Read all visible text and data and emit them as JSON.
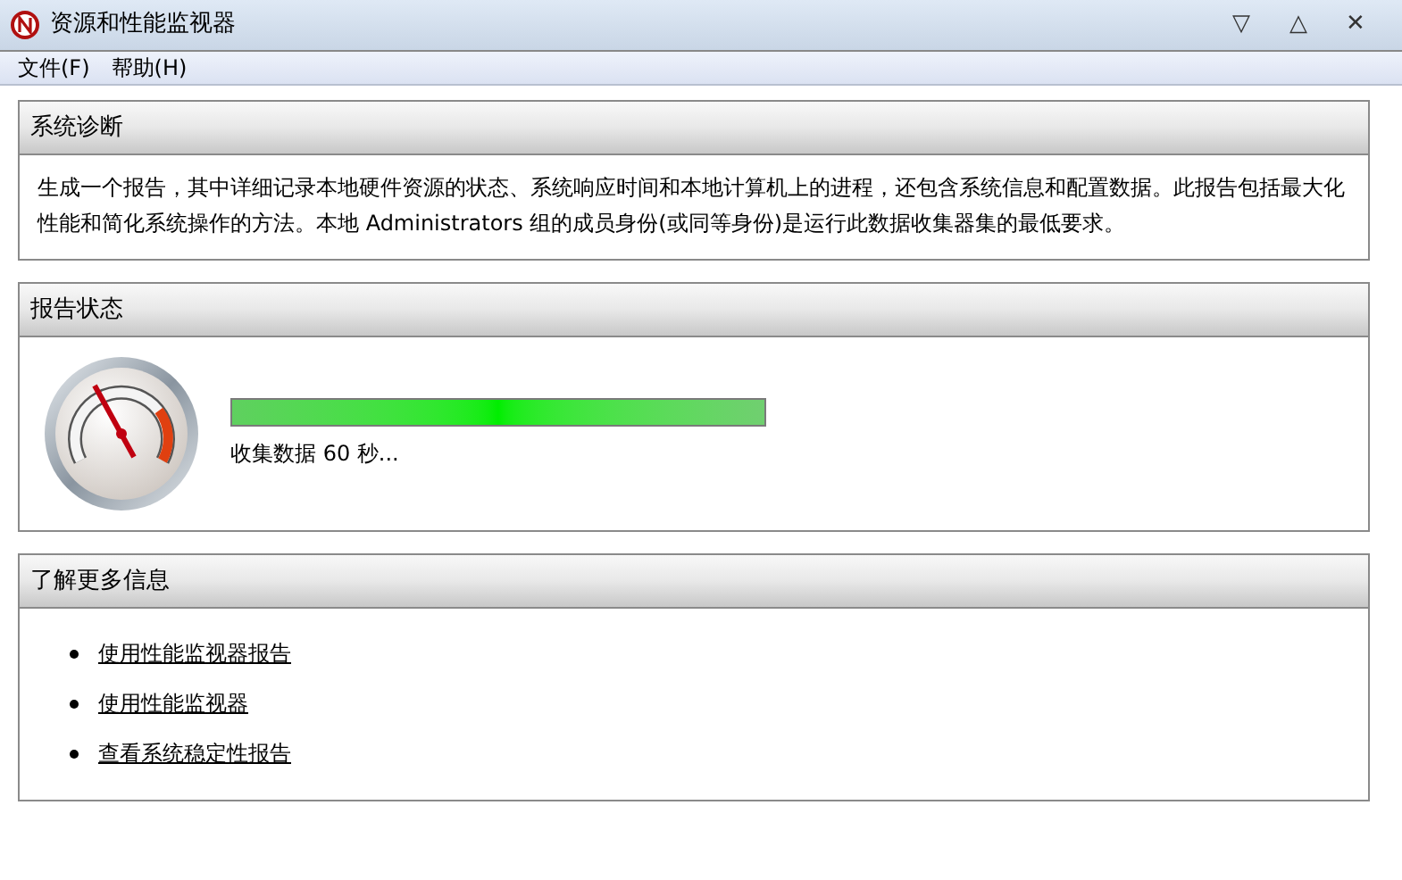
{
  "window": {
    "title": "资源和性能监视器",
    "controls": [
      "▽",
      "△",
      "✕"
    ]
  },
  "menu": [
    {
      "label": "文件(F)"
    },
    {
      "label": "帮助(H)"
    }
  ],
  "sections": [
    {
      "kind": "text",
      "title": "系统诊断",
      "text": "生成一个报告，其中详细记录本地硬件资源的状态、系统响应时间和本地计算机上的进程，还包含系统信息和配置数据。此报告包括最大化性能和简化系统操作的方法。本地 Administrators 组的成员身份(或同等身份)是运行此数据收集器集的最低要求。"
    },
    {
      "kind": "status",
      "title": "报告状态",
      "progress": {
        "level": 1.0,
        "caption": "收集数据 60 秒..."
      }
    },
    {
      "kind": "links",
      "title": "了解更多信息",
      "links": [
        "使用性能监视器报告",
        "使用性能监视器",
        "查看系统稳定性报告"
      ]
    }
  ]
}
